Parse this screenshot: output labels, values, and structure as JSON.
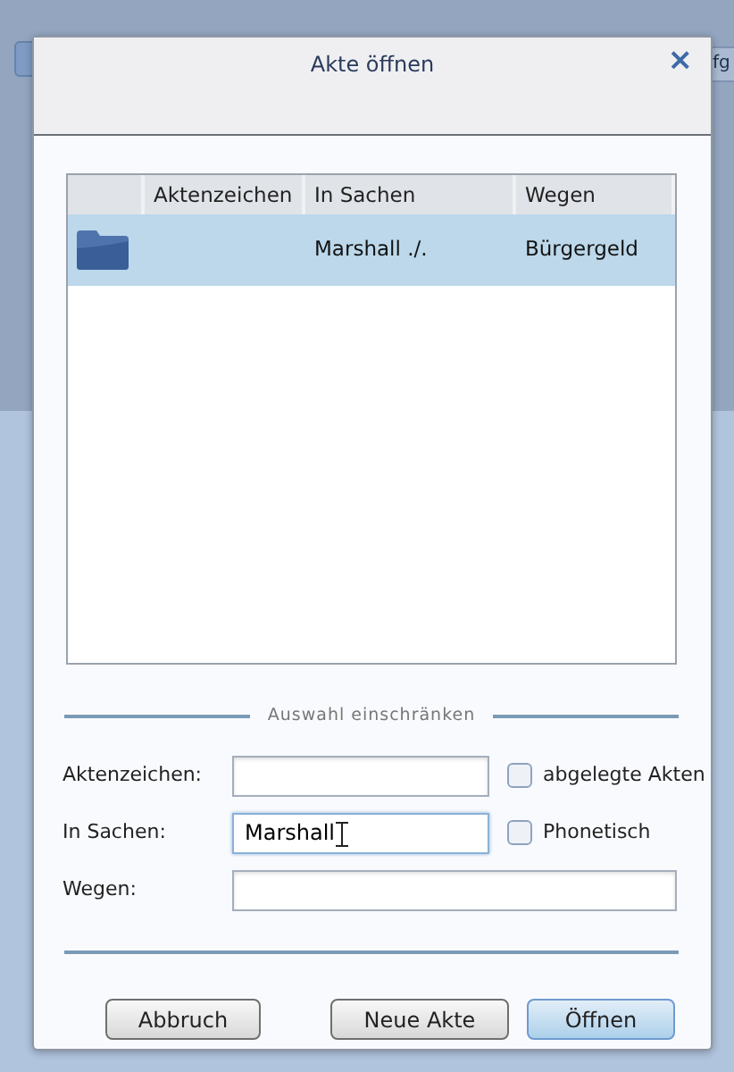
{
  "background": {
    "tab_text": "fg"
  },
  "dialog": {
    "title": "Akte öffnen",
    "close": "×"
  },
  "table": {
    "columns": [
      "Aktenzeichen",
      "In Sachen",
      "Wegen"
    ],
    "rows": [
      {
        "kind": "folder",
        "in_sachen": "Marshall ./.",
        "wegen": "Bürgergeld",
        "selected": true
      }
    ]
  },
  "filter": {
    "legend": "Auswahl einschränken",
    "fields": [
      {
        "label": "Aktenzeichen:",
        "focused": false,
        "checkbox": {
          "label": "abgelegte Akten",
          "checked": false
        }
      },
      {
        "label": "In Sachen:",
        "value": "Marshall",
        "focused": true,
        "checkbox": {
          "label": "Phonetisch",
          "checked": false
        }
      },
      {
        "label": "Wegen:",
        "focused": false
      }
    ]
  },
  "buttons": [
    {
      "label": "Abbruch",
      "default": false
    },
    {
      "label": "Neue Akte",
      "default": false
    },
    {
      "label": "Öffnen",
      "default": true
    }
  ]
}
